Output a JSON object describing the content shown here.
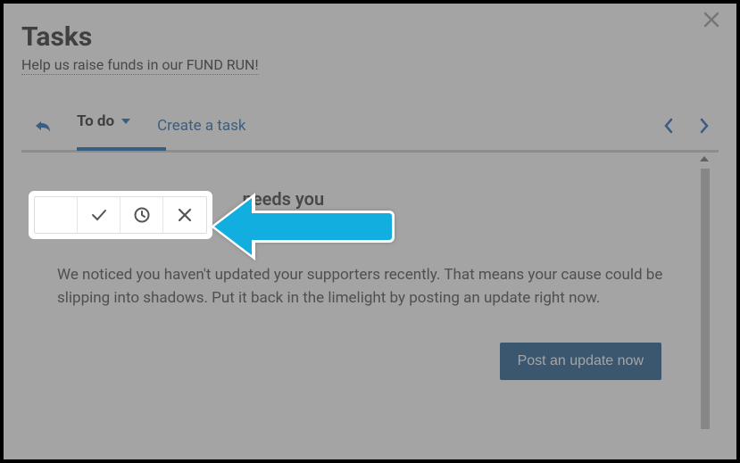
{
  "header": {
    "title": "Tasks",
    "subtitle": "Help us raise funds in our FUND RUN!"
  },
  "toolbar": {
    "filter_label": "To do",
    "create_label": "Create a task"
  },
  "task": {
    "title_partial": "needs you",
    "body": "We noticed you haven't updated your supporters recently. That means your cause could be slipping into shadows. Put it back in the limelight by posting an update right now.",
    "cta_label": "Post an update now"
  },
  "action_icons": {
    "check": "check-icon",
    "clock": "clock-icon",
    "dismiss": "x-icon"
  }
}
